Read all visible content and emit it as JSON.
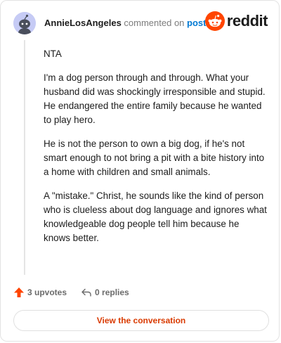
{
  "comment": {
    "author": "AnnieLosAngeles",
    "action_text": "commented on",
    "post_link": "post",
    "paragraphs": [
      "NTA",
      "I'm a dog person through and through. What your husband did was shockingly irresponsible and stupid. He endangered the entire family because he wanted to play hero.",
      "He is not the person to own a big dog, if he's not smart enough to not bring a pit with a bite history into a home with children and small animals.",
      "A \"mistake.\" Christ, he sounds like the kind of person who is clueless about dog language and ignores what knowledgeable dog people tell him because he knows better."
    ],
    "upvotes": "3 upvotes",
    "replies": "0 replies"
  },
  "brand": {
    "name": "reddit",
    "color": "#ff4500"
  },
  "footer": {
    "button_label": "View the conversation"
  },
  "icons": {
    "avatar": "snoo-avatar-icon",
    "upvote": "upvote-arrow-icon",
    "reply": "reply-arrow-icon",
    "logo": "reddit-logo-icon"
  }
}
